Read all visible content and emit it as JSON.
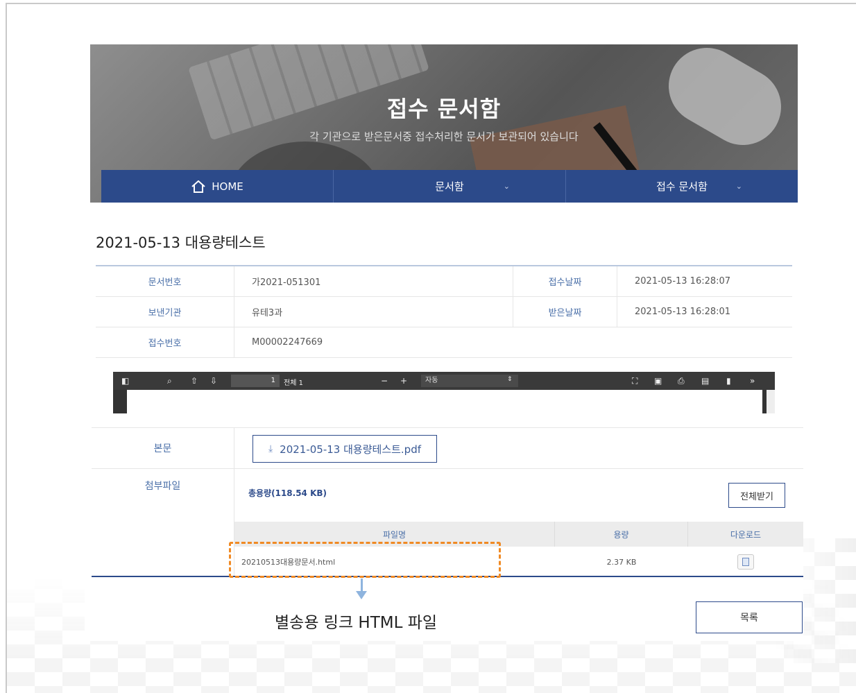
{
  "hero": {
    "title": "접수 문서함",
    "subtitle": "각 기관으로 받은문서중 접수처리한 문서가 보관되어 있습니다"
  },
  "nav": {
    "home_label": "HOME",
    "item1": "문서함",
    "item2": "접수 문서함",
    "chevron": "⌄"
  },
  "doc": {
    "title": "2021-05-13 대용량테스트"
  },
  "info": {
    "doc_no_label": "문서번호",
    "doc_no": "가2021-051301",
    "receive_date_label": "접수날짜",
    "receive_date": "2021-05-13 16:28:07",
    "sender_label": "보낸기관",
    "sender": "유테3과",
    "received_date_label": "받은날짜",
    "received_date": "2021-05-13 16:28:01",
    "reception_no_label": "접수번호",
    "reception_no": "M00002247669"
  },
  "viewer": {
    "page_value": "1",
    "page_total": "전체 1",
    "zoom": "자동",
    "minus": "−",
    "plus": "+"
  },
  "body": {
    "label": "본문",
    "pdf_file": "2021-05-13 대용량테스트.pdf"
  },
  "attachments": {
    "label": "첨부파일",
    "total": "총용량(118.54 KB)",
    "download_all": "전체받기",
    "headers": {
      "name": "파일명",
      "size": "용량",
      "download": "다운로드"
    },
    "files": [
      {
        "name": "20210513대용량문서.html",
        "size": "2.37 KB"
      }
    ]
  },
  "annotation": "별송용 링크 HTML 파일",
  "list_button": "목록",
  "colors": {
    "nav_blue": "#2c4a8a",
    "highlight_orange": "#f08a24",
    "label_blue": "#4a6fa8"
  }
}
